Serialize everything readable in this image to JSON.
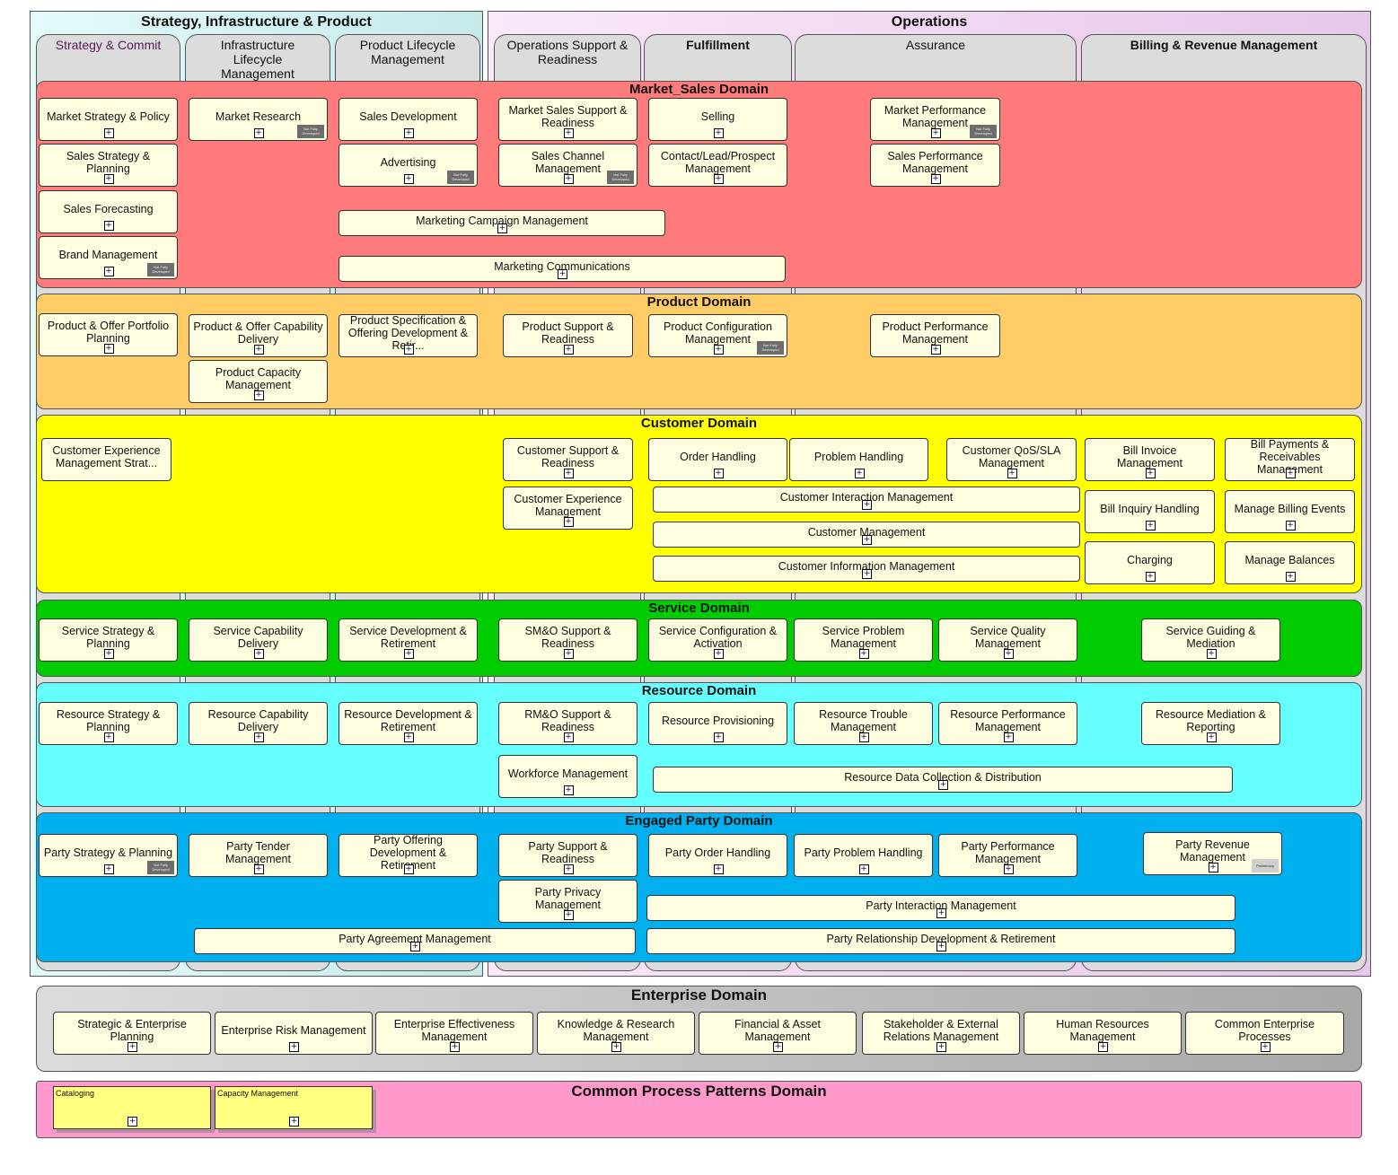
{
  "groups": {
    "sip": {
      "title": "Strategy, Infrastructure & Product"
    },
    "ops": {
      "title": "Operations"
    }
  },
  "columns": [
    {
      "label": "Strategy & Commit"
    },
    {
      "label": "Infrastructure Lifecycle Management"
    },
    {
      "label": "Product Lifecycle Management"
    },
    {
      "label": "Operations Support & Readiness"
    },
    {
      "label": "Fulfillment"
    },
    {
      "label": "Assurance"
    },
    {
      "label": "Billing & Revenue Management"
    }
  ],
  "badges": {
    "not_fully_developed": "Not Fully Developed",
    "preliminary": "Preliminary"
  },
  "expand_glyph": "+",
  "domains": {
    "market_sales": {
      "title": "Market_Sales Domain",
      "color": "#ff7b7b",
      "boxes": [
        "Market Strategy & Policy",
        "Sales Strategy & Planning",
        "Sales Forecasting",
        "Brand Management",
        "Market Research",
        "Sales Development",
        "Advertising",
        "Marketing Campaign Management",
        "Marketing Communications",
        "Market Sales Support & Readiness",
        "Sales Channel Management",
        "Selling",
        "Contact/Lead/Prospect Management",
        "Market Performance Management",
        "Sales Performance Management"
      ]
    },
    "product": {
      "title": "Product Domain",
      "color": "#ffcc66",
      "boxes": [
        "Product & Offer Portfolio Planning",
        "Product & Offer Capability Delivery",
        "Product Capacity Management",
        "Product Specification & Offering Development & Retir...",
        "Product Support & Readiness",
        "Product Configuration Management",
        "Product Performance Management"
      ]
    },
    "customer": {
      "title": "Customer Domain",
      "color": "#ffff00",
      "boxes": [
        "Customer Experience Management Strat...",
        "Customer Support & Readiness",
        "Customer Experience Management",
        "Order Handling",
        "Problem Handling",
        "Customer QoS/SLA Management",
        "Customer Interaction Management",
        "Customer Management",
        "Customer Information Management",
        "Bill Invoice Management",
        "Bill Payments & Receivables Management",
        "Bill Inquiry Handling",
        "Manage Billing Events",
        "Charging",
        "Manage Balances"
      ]
    },
    "service": {
      "title": "Service Domain",
      "color": "#00cc00",
      "boxes": [
        "Service Strategy & Planning",
        "Service Capability Delivery",
        "Service Development & Retirement",
        "SM&O Support & Readiness",
        "Service Configuration & Activation",
        "Service Problem Management",
        "Service Quality Management",
        "Service Guiding & Mediation"
      ]
    },
    "resource": {
      "title": "Resource Domain",
      "color": "#66ffff",
      "boxes": [
        "Resource Strategy & Planning",
        "Resource Capability Delivery",
        "Resource Development & Retirement",
        "RM&O Support & Readiness",
        "Workforce Management",
        "Resource Provisioning",
        "Resource Trouble Management",
        "Resource Performance Management",
        "Resource Mediation & Reporting",
        "Resource Data Collection & Distribution"
      ]
    },
    "party": {
      "title": "Engaged Party Domain",
      "color": "#00b0ee",
      "boxes": [
        "Party Strategy & Planning",
        "Party Tender Management",
        "Party Offering Development & Retirement",
        "Party Support & Readiness",
        "Party Privacy Management",
        "Party Order Handling",
        "Party Problem Handling",
        "Party Performance Management",
        "Party Revenue Management",
        "Party Interaction Management",
        "Party Agreement Management",
        "Party Relationship Development & Retirement"
      ]
    },
    "enterprise": {
      "title": "Enterprise Domain",
      "color": "#bdbdbd",
      "boxes": [
        "Strategic & Enterprise Planning",
        "Enterprise Risk Management",
        "Enterprise Effectiveness Management",
        "Knowledge & Research Management",
        "Financial & Asset Management",
        "Stakeholder & External Relations Management",
        "Human Resources Management",
        "Common Enterprise Processes"
      ]
    },
    "patterns": {
      "title": "Common Process Patterns Domain",
      "color": "#ff99cc",
      "boxes": [
        "Cataloging",
        "Capacity Management"
      ]
    }
  }
}
